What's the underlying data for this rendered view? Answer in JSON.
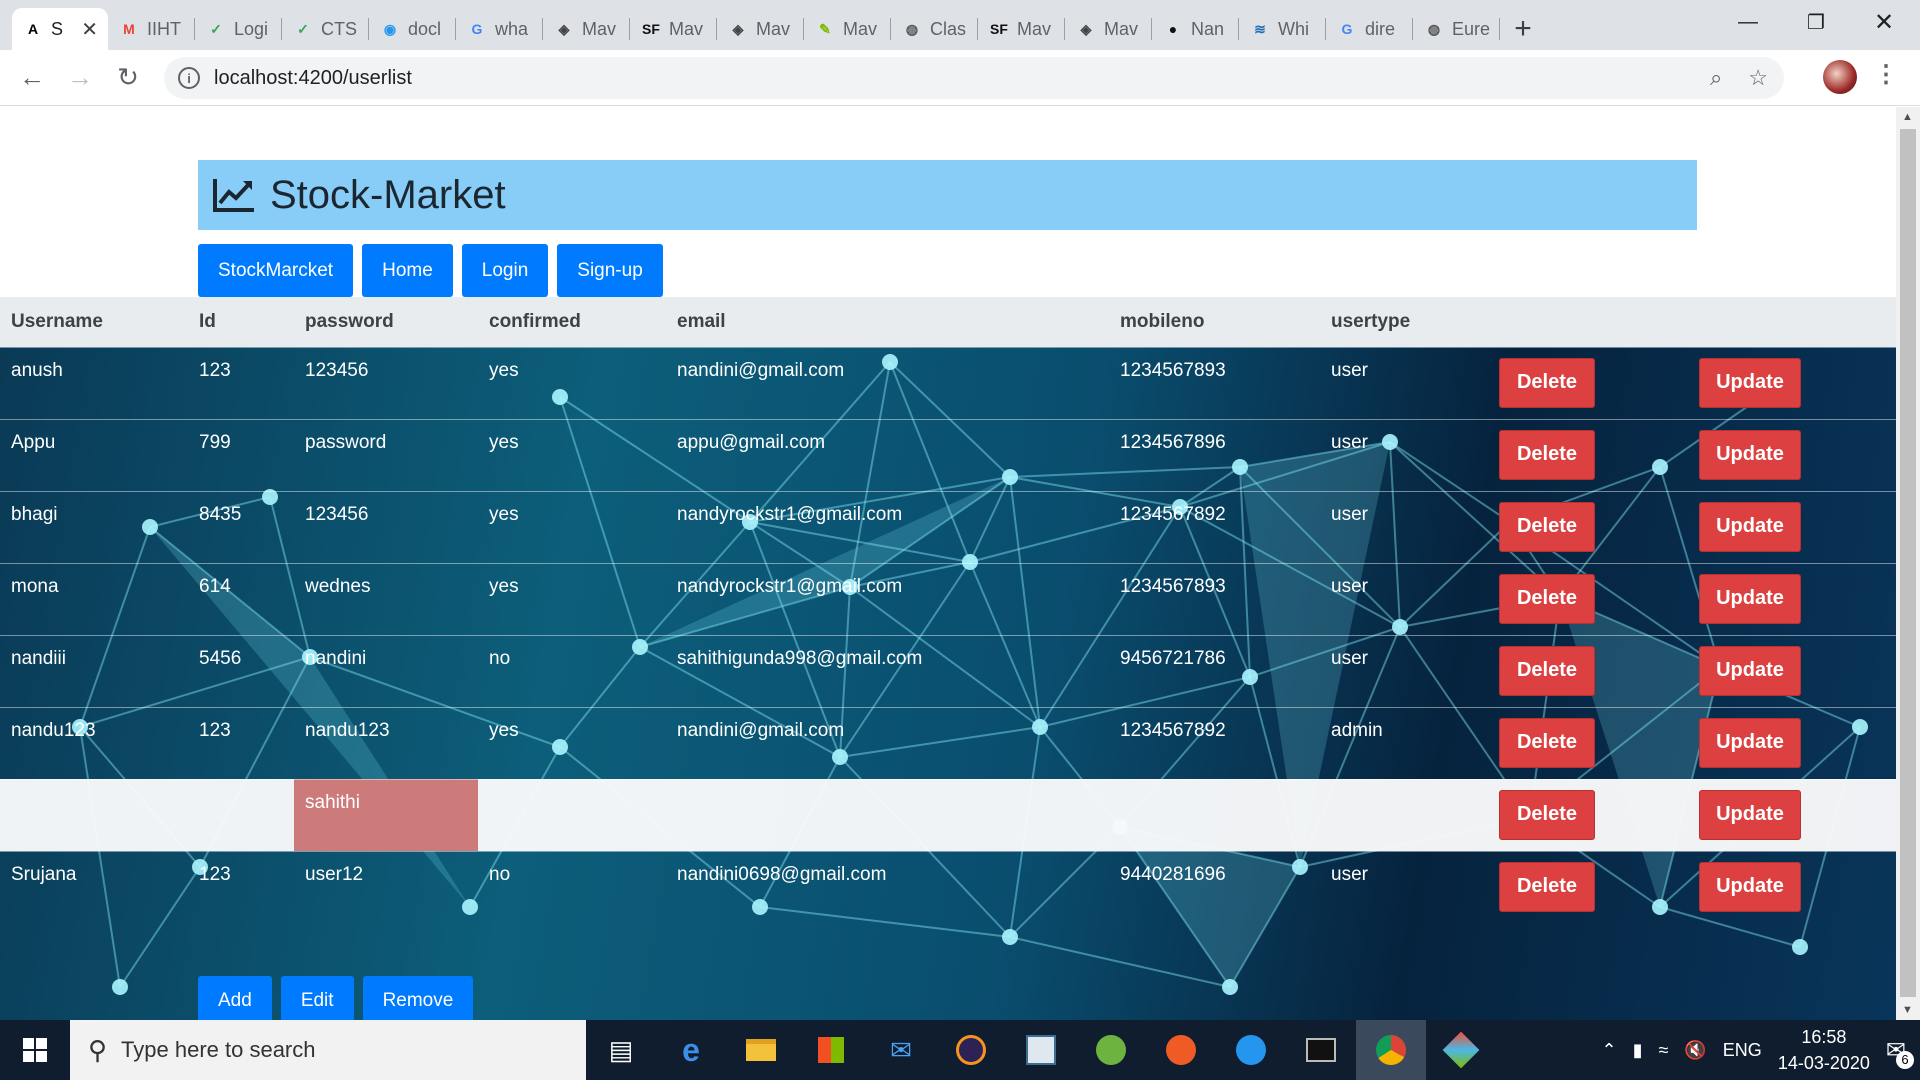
{
  "browser": {
    "tabs": [
      {
        "label": "S",
        "icon": "angular-icon",
        "active": true
      },
      {
        "label": "IIHT",
        "icon": "gmail-icon"
      },
      {
        "label": "Logi",
        "icon": "check-icon"
      },
      {
        "label": "CTS",
        "icon": "check-icon"
      },
      {
        "label": "docl",
        "icon": "docker-icon"
      },
      {
        "label": "wha",
        "icon": "google-icon"
      },
      {
        "label": "Mav",
        "icon": "diamond-icon"
      },
      {
        "label": "Mav",
        "icon": "sf-icon"
      },
      {
        "label": "Mav",
        "icon": "diamond-icon"
      },
      {
        "label": "Mav",
        "icon": "feather-icon"
      },
      {
        "label": "Clas",
        "icon": "globe-icon"
      },
      {
        "label": "Mav",
        "icon": "sf-icon"
      },
      {
        "label": "Mav",
        "icon": "diamond-icon"
      },
      {
        "label": "Nan",
        "icon": "github-icon"
      },
      {
        "label": "Whi",
        "icon": "wave-icon"
      },
      {
        "label": "dire",
        "icon": "google-icon"
      },
      {
        "label": "Eure",
        "icon": "globe-icon"
      }
    ],
    "url": "localhost:4200/userlist"
  },
  "app": {
    "title": "Stock-Market",
    "nav": [
      "StockMarcket",
      "Home",
      "Login",
      "Sign-up"
    ],
    "table": {
      "headers": [
        "Username",
        "Id",
        "password",
        "confirmed",
        "email",
        "mobileno",
        "usertype"
      ],
      "rows": [
        {
          "username": "anush",
          "id": "123",
          "password": "123456",
          "confirmed": "yes",
          "email": "nandini@gmail.com",
          "mobileno": "1234567893",
          "usertype": "user"
        },
        {
          "username": "Appu",
          "id": "799",
          "password": "password",
          "confirmed": "yes",
          "email": "appu@gmail.com",
          "mobileno": "1234567896",
          "usertype": "user"
        },
        {
          "username": "bhagi",
          "id": "8435",
          "password": "123456",
          "confirmed": "yes",
          "email": "nandyrockstr1@gmail.com",
          "mobileno": "1234567892",
          "usertype": "user"
        },
        {
          "username": "mona",
          "id": "614",
          "password": "wednes",
          "confirmed": "yes",
          "email": "nandyrockstr1@gmail.com",
          "mobileno": "1234567893",
          "usertype": "user"
        },
        {
          "username": "nandiii",
          "id": "5456",
          "password": "nandini",
          "confirmed": "no",
          "email": "sahithigunda998@gmail.com",
          "mobileno": "9456721786",
          "usertype": "user"
        },
        {
          "username": "nandu123",
          "id": "123",
          "password": "nandu123",
          "confirmed": "yes",
          "email": "nandini@gmail.com",
          "mobileno": "1234567892",
          "usertype": "admin"
        },
        {
          "username": "",
          "id": "",
          "password": "sahithi",
          "confirmed": "",
          "email": "",
          "mobileno": "",
          "usertype": "",
          "editing": true
        },
        {
          "username": "Srujana",
          "id": "123",
          "password": "user12",
          "confirmed": "no",
          "email": "nandini0698@gmail.com",
          "mobileno": "9440281696",
          "usertype": "user"
        }
      ],
      "delete_label": "Delete",
      "update_label": "Update"
    },
    "actions": [
      "Add",
      "Edit",
      "Remove"
    ]
  },
  "taskbar": {
    "search_placeholder": "Type here to search",
    "language": "ENG",
    "time": "16:58",
    "date": "14-03-2020",
    "notification_count": "6"
  },
  "colors": {
    "banner": "#87cdf7",
    "primary_button": "#007bff",
    "danger_button": "#dc4040",
    "editing_cell": "#cc7a7a"
  }
}
